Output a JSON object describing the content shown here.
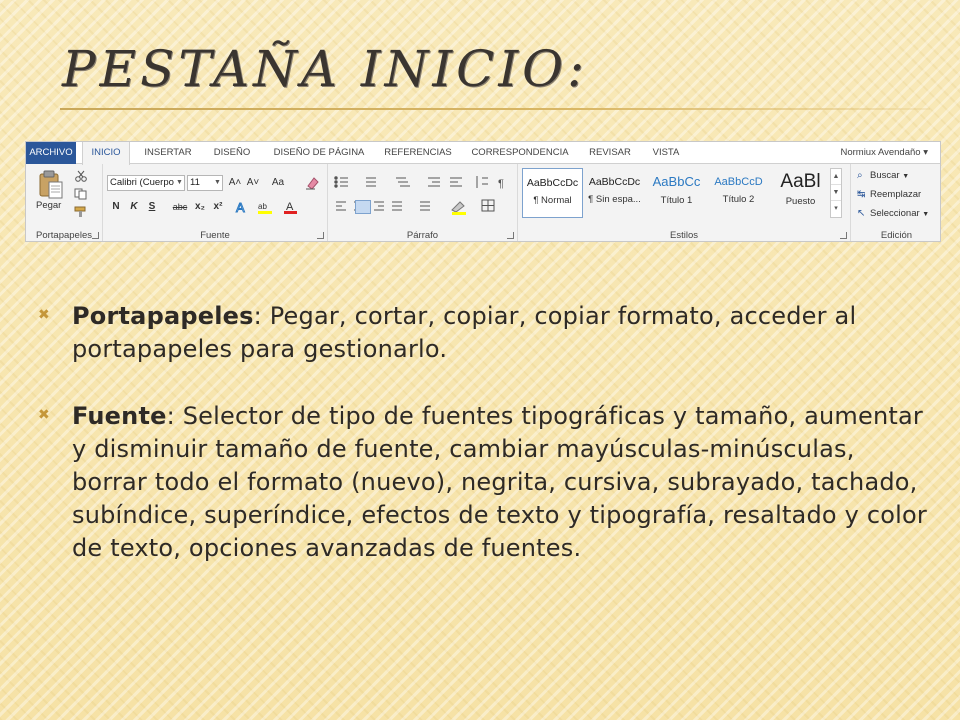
{
  "slide": {
    "title": "PESTAÑA INICIO:",
    "accent_color": "#c5973a"
  },
  "ribbon": {
    "tabs": [
      {
        "label": "ARCHIVO"
      },
      {
        "label": "INICIO"
      },
      {
        "label": "INSERTAR"
      },
      {
        "label": "DISEÑO"
      },
      {
        "label": "DISEÑO DE PÁGINA"
      },
      {
        "label": "REFERENCIAS"
      },
      {
        "label": "CORRESPONDENCIA"
      },
      {
        "label": "REVISAR"
      },
      {
        "label": "VISTA"
      }
    ],
    "user": "Normiux Avendaño",
    "groups": {
      "portapapeles": {
        "label": "Portapapeles",
        "paste_label": "Pegar"
      },
      "fuente": {
        "label": "Fuente",
        "font_name": "Calibri (Cuerpo",
        "font_size": "11",
        "grow": "A˄",
        "shrink": "A˅",
        "case": "Aa",
        "bold": "N",
        "italic": "K",
        "underline": "S",
        "strike": "abc",
        "sub": "x₂",
        "sup": "x²"
      },
      "parrafo": {
        "label": "Párrafo"
      },
      "estilos": {
        "label": "Estilos",
        "styles": [
          {
            "sample": "AaBbCcDc",
            "name": "¶ Normal"
          },
          {
            "sample": "AaBbCcDc",
            "name": "¶ Sin espa..."
          },
          {
            "sample": "AaBbCc",
            "name": "Título 1"
          },
          {
            "sample": "AaBbCcD",
            "name": "Título 2"
          },
          {
            "sample": "AaBl",
            "name": "Puesto"
          }
        ]
      },
      "edicion": {
        "label": "Edición",
        "buscar": "Buscar",
        "reemplazar": "Reemplazar",
        "seleccionar": "Seleccionar"
      }
    }
  },
  "bullets": [
    {
      "term": "Portapapeles",
      "text": ": Pegar, cortar, copiar, copiar formato, acceder al portapapeles para gestionarlo."
    },
    {
      "term": "Fuente",
      "text": ": Selector de tipo de fuentes tipográficas y tamaño, aumentar y disminuir tamaño de fuente, cambiar mayúsculas-minúsculas, borrar todo el formato (nuevo), negrita, cursiva, subrayado, tachado, subíndice, superíndice, efectos de texto y tipografía, resaltado y color de texto, opciones avanzadas de fuentes."
    }
  ]
}
